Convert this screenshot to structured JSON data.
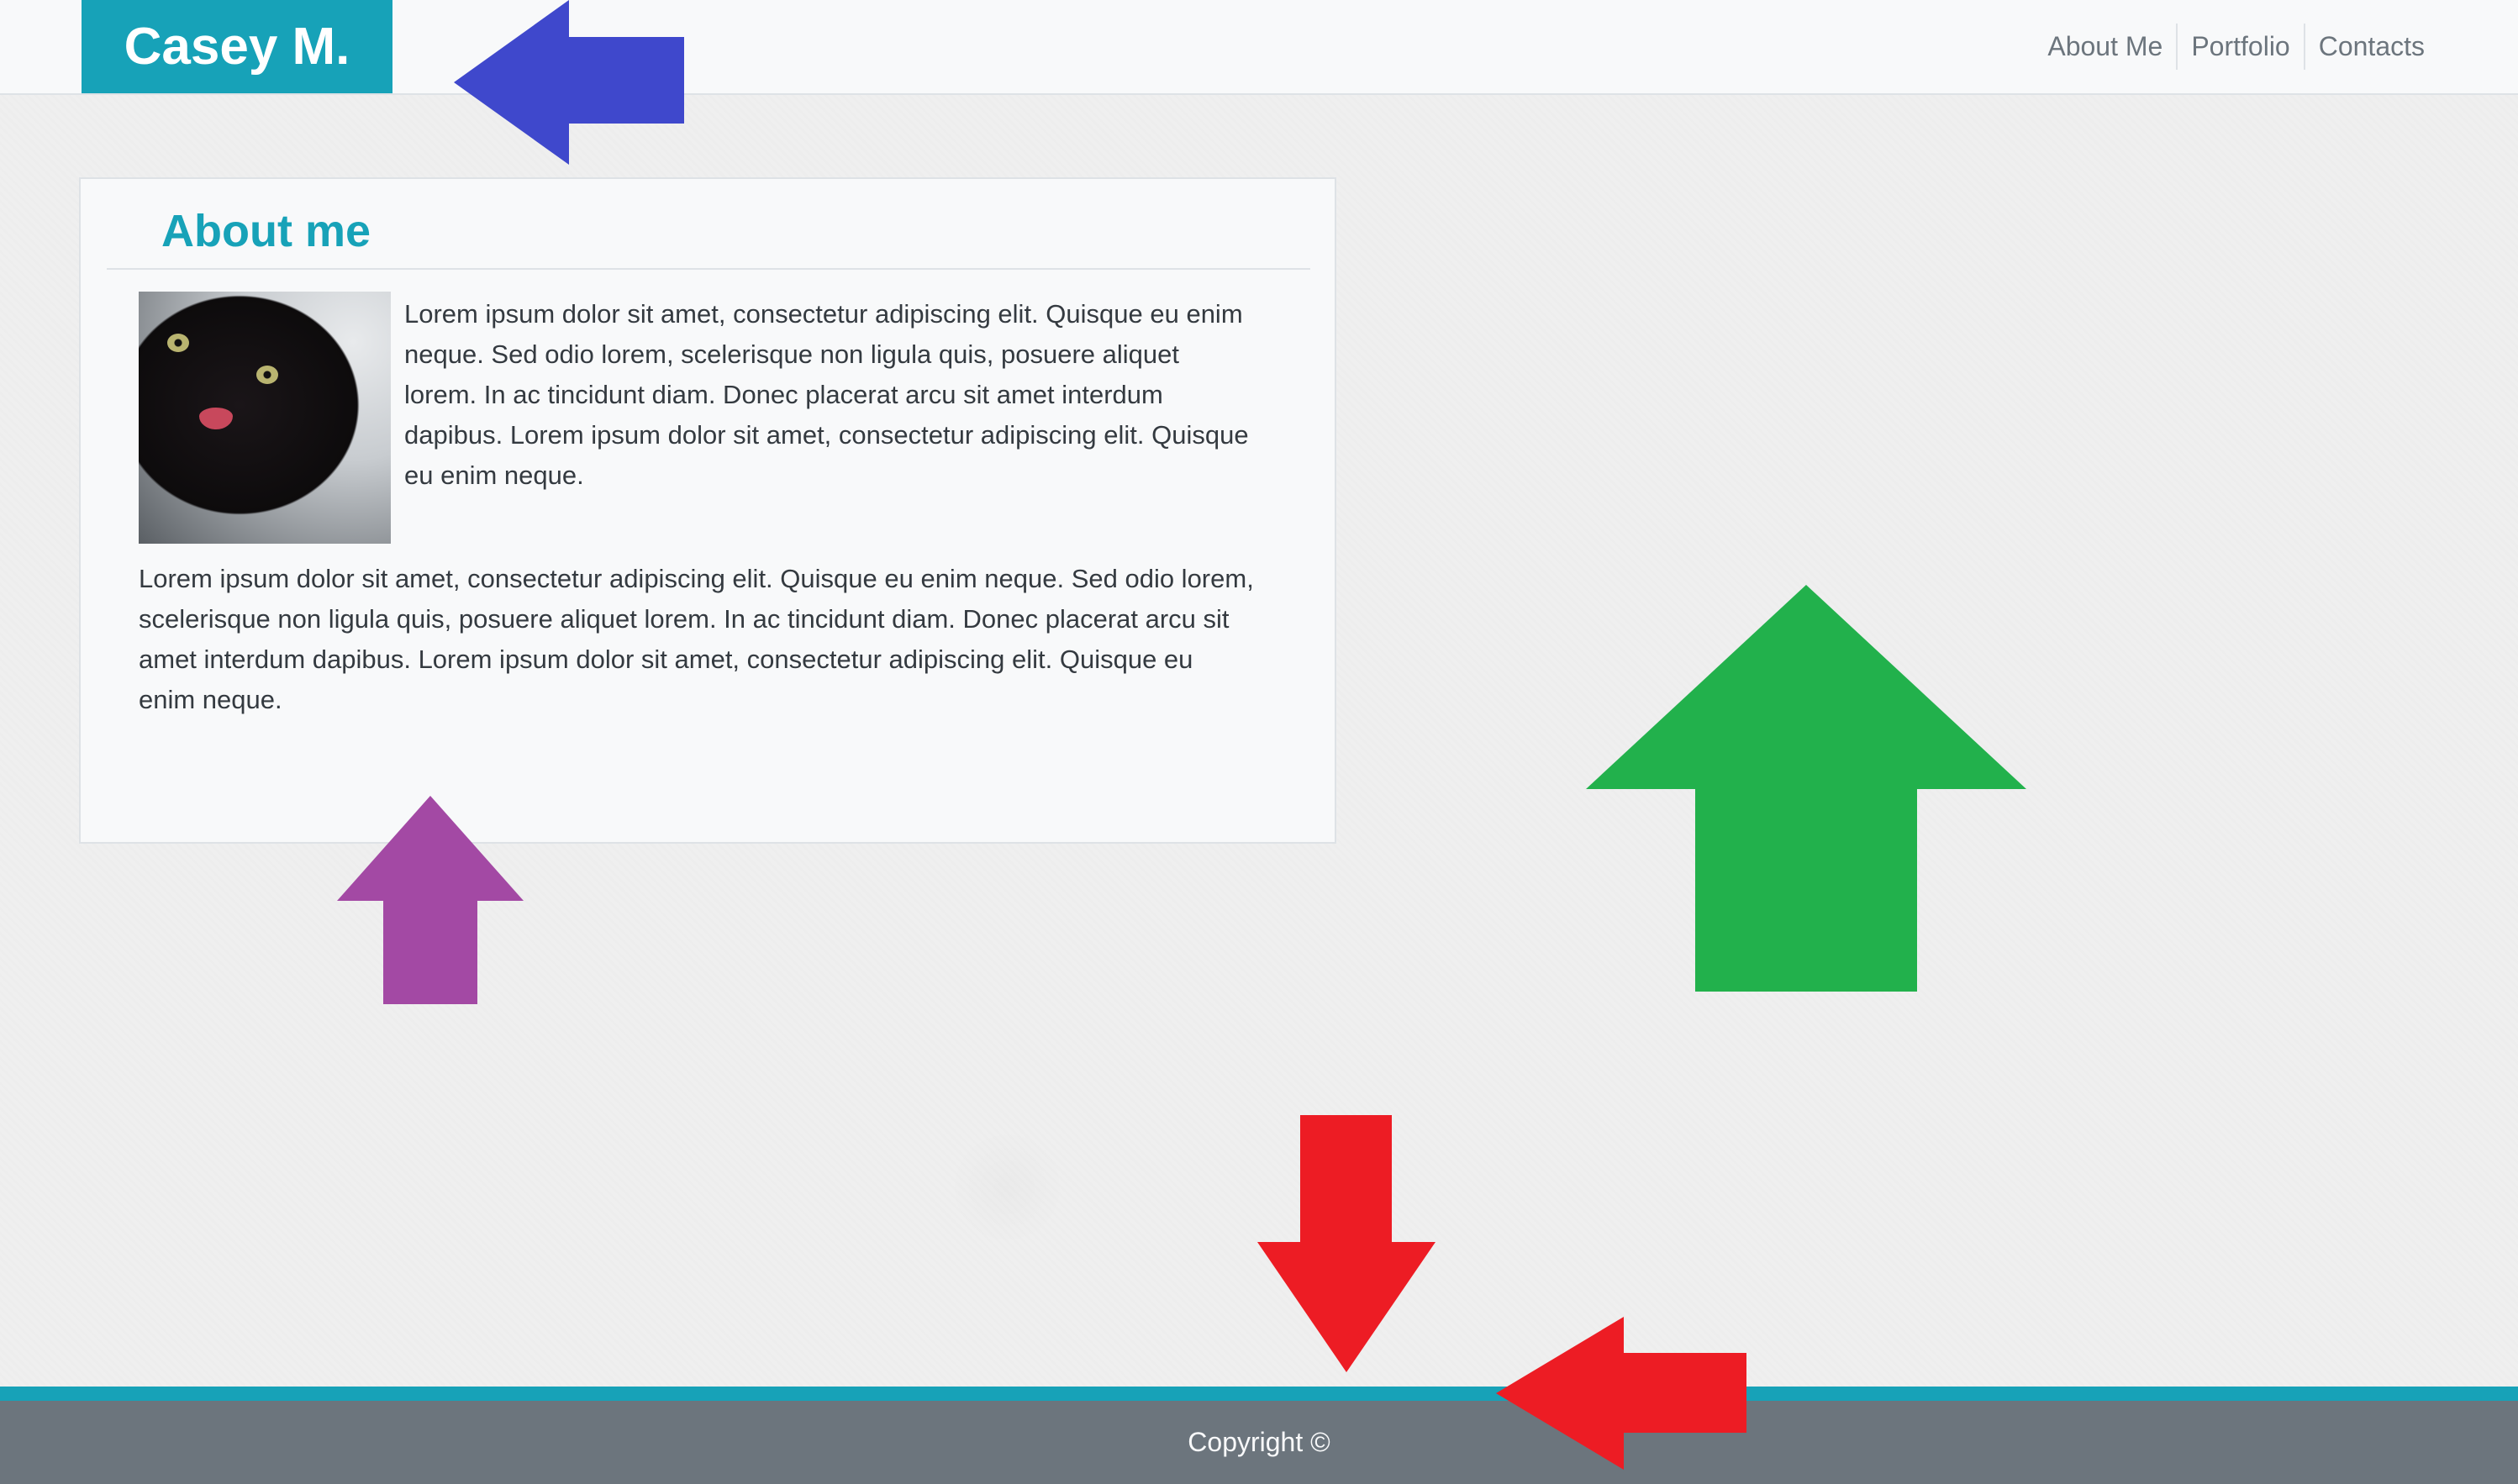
{
  "header": {
    "brand": "Casey M.",
    "nav": [
      "About Me",
      "Portfolio",
      "Contacts"
    ]
  },
  "about": {
    "title": "About me",
    "image_alt": "black cat",
    "paragraph_1": "Lorem ipsum dolor sit amet, consectetur adipiscing elit. Quisque eu enim neque. Sed odio lorem, scelerisque non ligula quis, posuere aliquet lorem. In ac tincidunt diam. Donec placerat arcu sit amet interdum dapibus. Lorem ipsum dolor sit amet, consectetur adipiscing elit. Quisque eu enim neque.",
    "paragraph_2": "Lorem ipsum dolor sit amet, consectetur adipiscing elit. Quisque eu enim neque. Sed odio lorem, scelerisque non ligula quis, posuere aliquet lorem. In ac tincidunt diam. Donec placerat arcu sit amet interdum dapibus. Lorem ipsum dolor sit amet, consectetur adipiscing elit. Quisque eu enim neque."
  },
  "footer": {
    "copyright": "Copyright ©"
  },
  "colors": {
    "accent": "#17a2b8",
    "footer_bg": "#6c757d",
    "navbar_bg": "#f8f9fa",
    "arrow_blue": "#3f48cc",
    "arrow_green": "#22b14c",
    "arrow_purple": "#a349a4",
    "arrow_red": "#ed1c24"
  },
  "annotations": [
    "arrow-left-blue",
    "arrow-up-green",
    "arrow-up-purple",
    "arrow-down-red",
    "arrow-left-red"
  ]
}
